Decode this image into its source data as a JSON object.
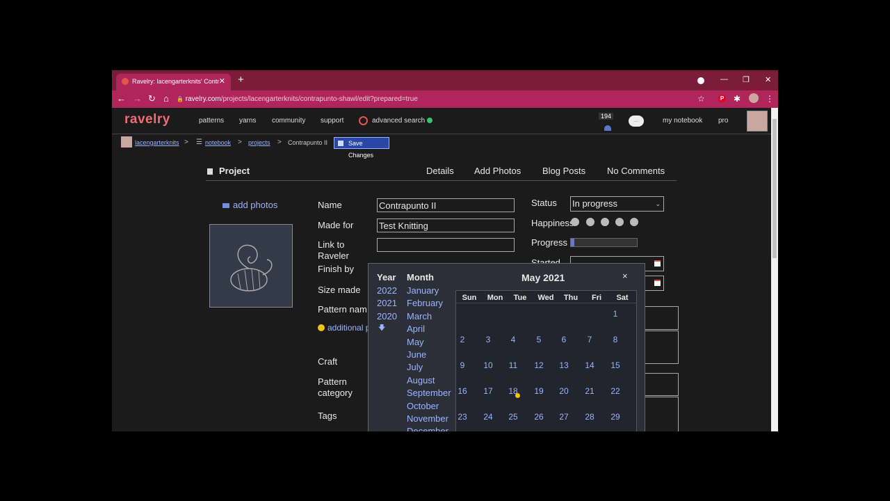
{
  "browser": {
    "tab_title": "Ravelry: lacengarterknits' Contrap",
    "tab_close": "✕",
    "new_tab": "+",
    "url_host": "ravelry.com",
    "url_path": "/projects/lacengarterknits/contrapunto-shawl/edit?prepared=true",
    "minimize": "—",
    "restore": "❐",
    "close": "✕",
    "back": "←",
    "forward": "→",
    "reload": "↻",
    "home": "⌂",
    "lock": "🔒",
    "star": "☆",
    "pin_letter": "P",
    "puzzle": "✱",
    "menu": "⋮"
  },
  "site": {
    "logo": "ravelry",
    "nav": [
      "patterns",
      "yarns",
      "community",
      "support",
      "advanced search"
    ],
    "message_count": "194",
    "chat_label": "...",
    "my_notebook": "my notebook",
    "pro": "pro"
  },
  "breadcrumb": {
    "user": "lacengarterknits",
    "notebook": "notebook",
    "projects": "projects",
    "current": "Contrapunto II",
    "save": "Save Changes",
    "sep": ">"
  },
  "project": {
    "title": "Project",
    "tabs": [
      "Details",
      "Add Photos",
      "Blog Posts",
      "No Comments"
    ],
    "add_photos": "add photos"
  },
  "form": {
    "name_label": "Name",
    "name_value": "Contrapunto II",
    "made_for_label": "Made for",
    "made_for_value": "Test Knitting",
    "link_label_1": "Link to",
    "link_label_2": "Raveler",
    "finish_label": "Finish by",
    "size_label": "Size made",
    "pattern_label": "Pattern nam",
    "additional": "additional p",
    "craft_label": "Craft",
    "category_label_1": "Pattern",
    "category_label_2": "category",
    "tags_label": "Tags",
    "status_label": "Status",
    "status_value": "In progress",
    "happiness_label": "Happiness",
    "progress_label": "Progress",
    "progress_fraction": 0.05,
    "started_label": "Started"
  },
  "calendar": {
    "year_header": "Year",
    "month_header": "Month",
    "years": [
      "2022",
      "2021",
      "2020"
    ],
    "more_years": "🡇",
    "months": [
      "January",
      "February",
      "March",
      "April",
      "May",
      "June",
      "July",
      "August",
      "September",
      "October",
      "November",
      "December"
    ],
    "title": "May 2021",
    "close": "×",
    "weekdays": [
      "Sun",
      "Mon",
      "Tue",
      "Wed",
      "Thu",
      "Fri",
      "Sat"
    ],
    "weeks": [
      [
        "",
        "",
        "",
        "",
        "",
        "",
        "1"
      ],
      [
        "2",
        "3",
        "4",
        "5",
        "6",
        "7",
        "8"
      ],
      [
        "9",
        "10",
        "11",
        "12",
        "13",
        "14",
        "15"
      ],
      [
        "16",
        "17",
        "18",
        "19",
        "20",
        "21",
        "22"
      ],
      [
        "23",
        "24",
        "25",
        "26",
        "27",
        "28",
        "29"
      ]
    ],
    "today": "18"
  }
}
